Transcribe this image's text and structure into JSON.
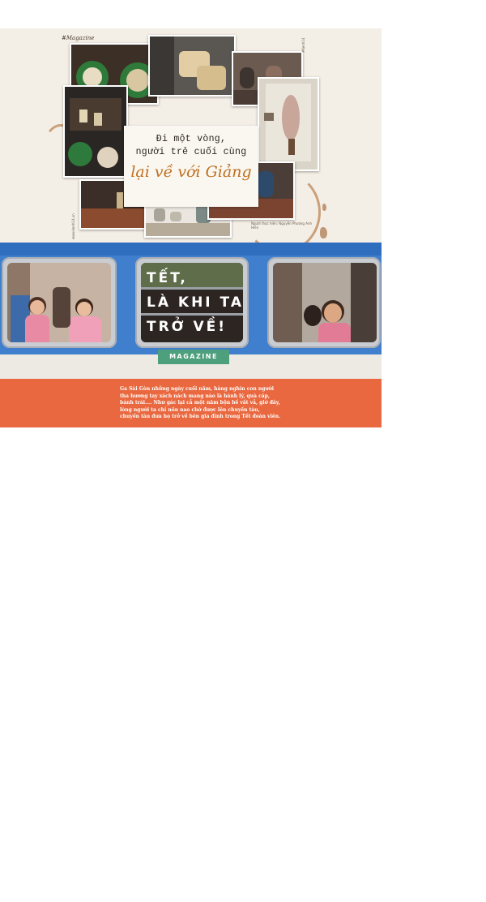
{
  "collage": {
    "brand": "#Magazine",
    "headline_line1": "Đi một vòng,",
    "headline_line2": "người trẻ cuối cùng",
    "headline_script": "lại về với Giảng",
    "credit": "Người thực hiện: Nguyễn Phương Anh Hiền",
    "side_tag": "#Kenh14",
    "site": "www.kenh14.vn"
  },
  "train": {
    "title_lines": [
      "TẾT,",
      "LÀ KHI TA",
      "TRỞ VỀ!"
    ],
    "badge": "MAGAZINE",
    "description_lines": [
      "Ga Sài Gòn những ngày cuối năm, hàng nghìn con người",
      "tha hương tay xách nách mang nào là hành lý, quà cáp,",
      "bánh trái.... Như gác lại cả một năm bộn bề vất vả, giờ đây,",
      "lòng người ta chỉ nôn nao chờ được lên chuyến tàu,",
      "chuyến tàu đưa họ trở về bên gia đình trong Tết đoàn viên."
    ]
  },
  "colors": {
    "collage_paper": "#f4efe6",
    "accent_script": "#c0701f",
    "train_blue": "#3f7fce",
    "train_orange": "#e9683f",
    "badge_green": "#4e9f7c"
  }
}
